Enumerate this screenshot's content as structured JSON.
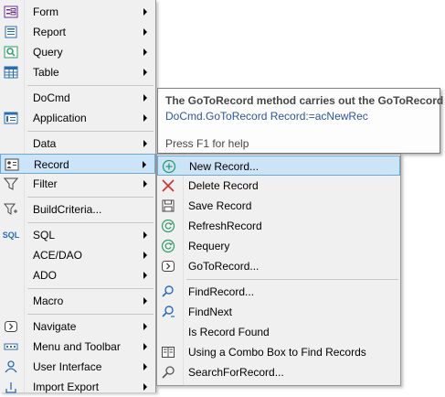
{
  "main_menu": {
    "items": [
      {
        "label": "Form",
        "icon": "form-icon",
        "arrow": true
      },
      {
        "label": "Report",
        "icon": "report-icon",
        "arrow": true
      },
      {
        "label": "Query",
        "icon": "query-icon",
        "arrow": true
      },
      {
        "label": "Table",
        "icon": "table-icon",
        "arrow": true
      },
      {
        "label": "DoCmd",
        "icon": "",
        "arrow": true
      },
      {
        "label": "Application",
        "icon": "application-icon",
        "arrow": true
      },
      {
        "label": "Data",
        "icon": "",
        "arrow": true
      },
      {
        "label": "Record",
        "icon": "record-icon",
        "arrow": true,
        "highlighted": true
      },
      {
        "label": "Filter",
        "icon": "filter-icon",
        "arrow": true
      },
      {
        "label": "BuildCriteria...",
        "icon": "build-criteria-icon",
        "arrow": false
      },
      {
        "label": "SQL",
        "icon": "sql-icon",
        "icon_text": "SQL",
        "arrow": true
      },
      {
        "label": "ACE/DAO",
        "icon": "",
        "arrow": true
      },
      {
        "label": "ADO",
        "icon": "",
        "arrow": true
      },
      {
        "label": "Macro",
        "icon": "",
        "arrow": true
      },
      {
        "label": "Navigate",
        "icon": "navigate-icon",
        "arrow": true
      },
      {
        "label": "Menu and Toolbar",
        "icon": "menu-toolbar-icon",
        "arrow": true
      },
      {
        "label": "User Interface",
        "icon": "user-interface-icon",
        "arrow": true
      },
      {
        "label": "Import Export",
        "icon": "import-export-icon",
        "arrow": true
      }
    ]
  },
  "tooltip": {
    "title": "The GoToRecord method carries out the GoToRecord",
    "code": "DoCmd.GoToRecord Record:=acNewRec",
    "help": "Press F1 for help"
  },
  "record_submenu": {
    "items": [
      {
        "label": "New Record...",
        "icon": "plus-circle-icon",
        "highlighted": true
      },
      {
        "label": "Delete Record",
        "icon": "delete-x-icon"
      },
      {
        "label": "Save Record",
        "icon": "save-icon"
      },
      {
        "label": "RefreshRecord",
        "icon": "refresh-icon"
      },
      {
        "label": "Requery",
        "icon": "requery-icon"
      },
      {
        "label": "GoToRecord...",
        "icon": "goto-record-icon"
      },
      {
        "label": "FindRecord...",
        "icon": "find-icon"
      },
      {
        "label": "FindNext",
        "icon": "find-next-icon"
      },
      {
        "label": "Is Record Found",
        "icon": ""
      },
      {
        "label": "Using a Combo Box to Find Records",
        "icon": "book-icon"
      },
      {
        "label": "SearchForRecord...",
        "icon": "search-record-icon"
      }
    ]
  },
  "colors": {
    "highlight": "#cce4f7",
    "highlight_border": "#6da8d8",
    "menu_bg": "#f0f0f0",
    "icon_blue": "#2b6cb0",
    "icon_green": "#2a9d6a",
    "icon_red": "#d32f2f"
  }
}
